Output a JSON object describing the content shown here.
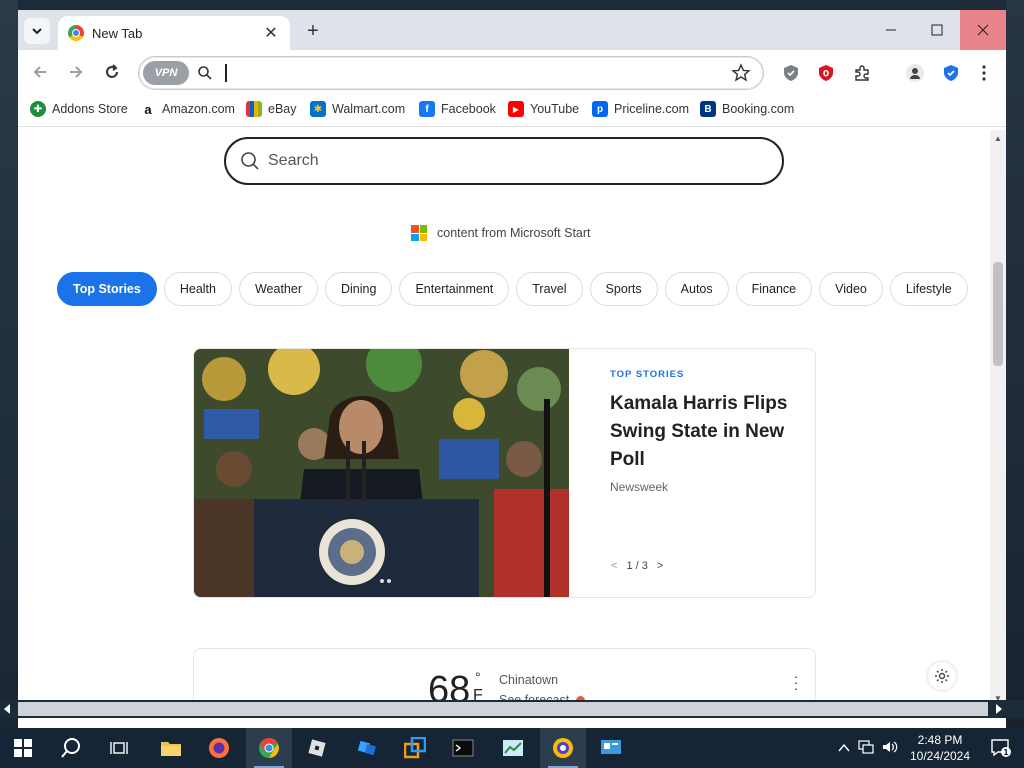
{
  "browser": {
    "tab_title": "New Tab",
    "new_tab_symbol": "+",
    "vpn_label": "VPN"
  },
  "bookmarks": [
    {
      "label": "Addons Store",
      "icon": "puzzle-green-icon",
      "color": "#1e8e3e"
    },
    {
      "label": "Amazon.com",
      "icon": "amazon-icon",
      "color": "#222222"
    },
    {
      "label": "eBay",
      "icon": "ebay-icon",
      "color": "#e53238"
    },
    {
      "label": "Walmart.com",
      "icon": "walmart-icon",
      "color": "#0071ce"
    },
    {
      "label": "Facebook",
      "icon": "facebook-icon",
      "color": "#1877f2"
    },
    {
      "label": "YouTube",
      "icon": "youtube-icon",
      "color": "#ff0000"
    },
    {
      "label": "Priceline.com",
      "icon": "priceline-icon",
      "color": "#0068ef"
    },
    {
      "label": "Booking.com",
      "icon": "booking-icon",
      "color": "#003580"
    }
  ],
  "page": {
    "search_placeholder": "Search",
    "content_source": "content from Microsoft Start",
    "categories": [
      "Top Stories",
      "Health",
      "Weather",
      "Dining",
      "Entertainment",
      "Travel",
      "Sports",
      "Autos",
      "Finance",
      "Video",
      "Lifestyle"
    ],
    "active_category": "Top Stories",
    "story": {
      "kicker": "TOP STORIES",
      "title": "Kamala Harris Flips Swing State in New Poll",
      "source": "Newsweek",
      "pager": "1 / 3",
      "prev": "<",
      "next": ">"
    },
    "weather": {
      "temperature": "68",
      "degree": "°",
      "unit": "F",
      "location": "Chinatown",
      "forecast_label": "See forecast"
    }
  },
  "taskbar": {
    "time": "2:48 PM",
    "date": "10/24/2024",
    "notification_count": "1"
  },
  "colors": {
    "accent": "#1a73e8",
    "close_hover": "#e8848a",
    "taskbar": "#152535"
  }
}
